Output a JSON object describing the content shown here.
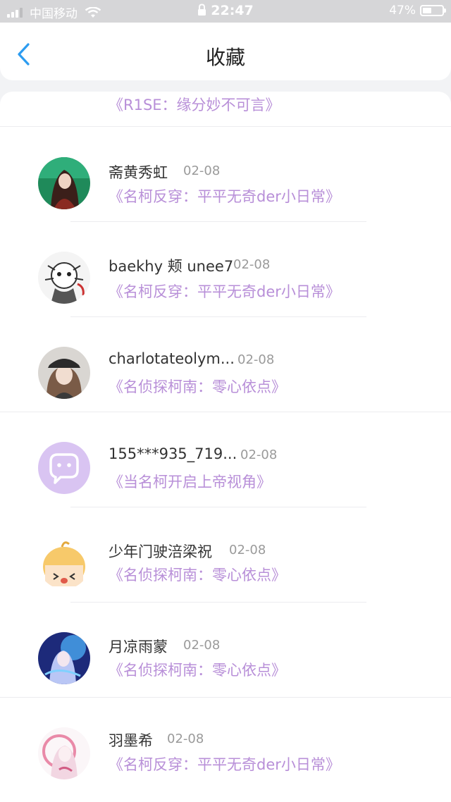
{
  "status_bar": {
    "carrier": "中国移动",
    "time": "22:47",
    "battery_percent": "47%",
    "battery_level": 0.47
  },
  "header": {
    "title": "收藏",
    "back_icon": "chevron-left-icon"
  },
  "colors": {
    "accent": "#2c9cf0",
    "work_title": "#b88fd8",
    "date": "#9a9a9a"
  },
  "items": [
    {
      "username": "",
      "date": "",
      "work": "《R1SE：缘分妙不可言》",
      "avatar": "user-photo"
    },
    {
      "username": "斋黄秀虹",
      "date": "02-08",
      "work": "《名柯反穿：平平无奇der小日常》",
      "avatar": "anime-character-dark-hair"
    },
    {
      "username": "baekhy 颊 unee7",
      "date": "02-08",
      "work": "《名柯反穿：平平无奇der小日常》",
      "avatar": "sketch-character"
    },
    {
      "username": "charlotateolym...",
      "date": "02-08",
      "work": "《名侦探柯南：零心依点》",
      "avatar": "girl-with-cap-photo"
    },
    {
      "username": "155***935_719...",
      "date": "02-08",
      "work": "《当名柯开启上帝视角》",
      "avatar": "default-chat-avatar"
    },
    {
      "username": "少年门驶涪梁祝",
      "date": "02-08",
      "work": "《名侦探柯南：零心依点》",
      "avatar": "cartoon-chibi"
    },
    {
      "username": "月凉雨蒙",
      "date": "02-08",
      "work": "《名侦探柯南：零心依点》",
      "avatar": "blue-anime-girl"
    },
    {
      "username": "羽墨希",
      "date": "02-08",
      "work": "《名柯反穿：平平无奇der小日常》",
      "avatar": "pink-anime-girl"
    }
  ]
}
